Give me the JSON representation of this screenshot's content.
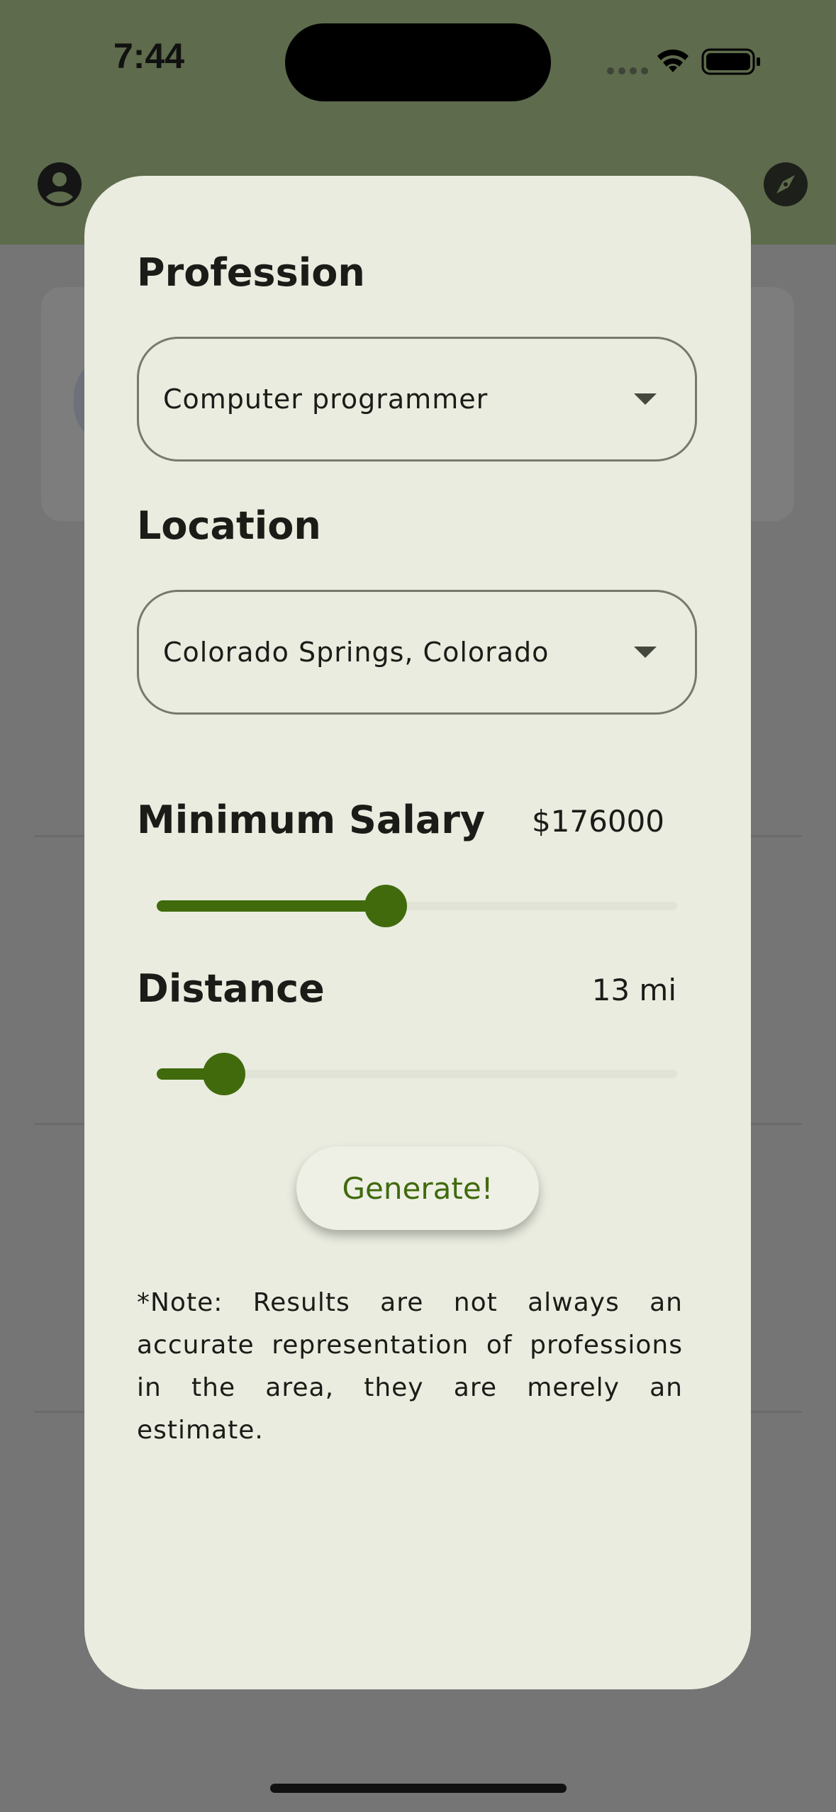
{
  "status_bar": {
    "time": "7:44"
  },
  "icons": {
    "account": "account-circle-icon",
    "explore": "compass-icon",
    "wifi": "wifi-icon",
    "battery": "battery-icon",
    "caret": "dropdown-caret-icon"
  },
  "form": {
    "profession": {
      "label": "Profession",
      "value": "Computer programmer"
    },
    "location": {
      "label": "Location",
      "value": "Colorado Springs, Colorado"
    },
    "min_salary": {
      "label": "Minimum Salary",
      "display": "$176000",
      "fill_fraction": 0.44
    },
    "distance": {
      "label": "Distance",
      "display": "13 mi",
      "fill_fraction": 0.13
    },
    "generate_label": "Generate!",
    "note": "*Note: Results are not always an accurate representation of professions in the area, they are merely an estimate."
  },
  "colors": {
    "accent": "#416a0d",
    "sheet_background": "#e9ecdf",
    "app_bar": "#5e6b4c",
    "scrim": "#747574"
  }
}
